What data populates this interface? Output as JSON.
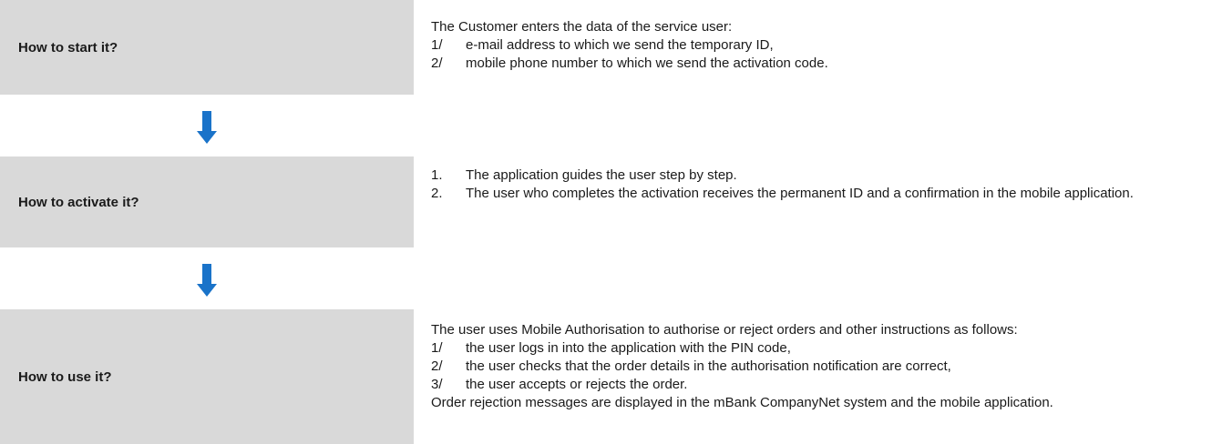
{
  "accent_color": "#1a73c9",
  "box_color": "#d9d9d9",
  "steps": [
    {
      "title": "How to start it?",
      "intro": "The Customer enters the data of the service user:",
      "items": [
        {
          "marker": "1/",
          "text": "e-mail address to which we send the temporary ID,"
        },
        {
          "marker": "2/",
          "text": "mobile phone number to which we send the activation code."
        }
      ]
    },
    {
      "title": "How to activate it?",
      "items": [
        {
          "marker": "1.",
          "text": "The application guides the user step by step."
        },
        {
          "marker": "2.",
          "text": "The user who completes the activation receives the permanent ID and a confirmation in the mobile application."
        }
      ]
    },
    {
      "title": "How to use it?",
      "intro": "The user uses Mobile Authorisation to authorise or reject orders and other instructions as follows:",
      "items": [
        {
          "marker": "1/",
          "text": "the user logs in into the application with the PIN code,"
        },
        {
          "marker": "2/",
          "text": "the user checks that the order details in the authorisation notification are correct,"
        },
        {
          "marker": "3/",
          "text": "the user accepts or rejects the order."
        }
      ],
      "outro": "Order rejection messages are displayed in the mBank CompanyNet system and the mobile application."
    }
  ]
}
